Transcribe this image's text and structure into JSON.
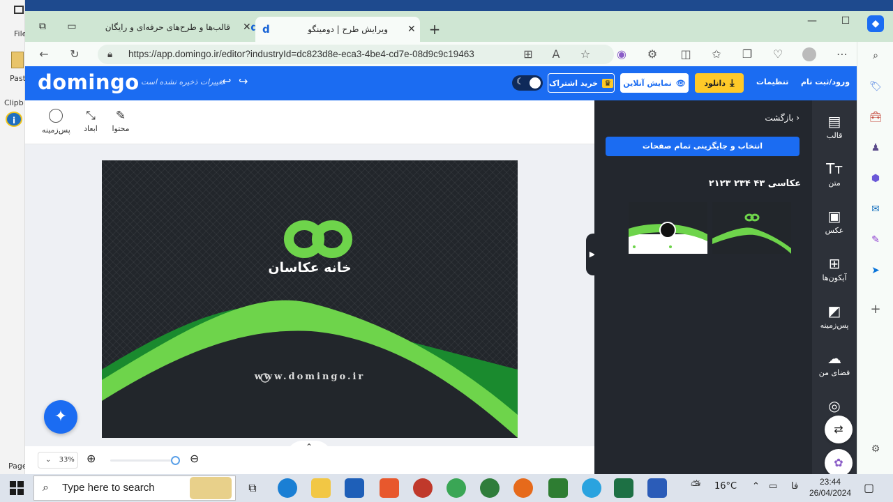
{
  "background_app": {
    "file_label": "File",
    "paste_label": "Past",
    "clipboard_label": "Clipb",
    "page_label": "Page"
  },
  "browser": {
    "tabs": [
      {
        "title": "قالب‌ها و طرح‌های حرفه‌ای و رایگان",
        "active": false
      },
      {
        "title": "ویرایش طرح | دومینگو",
        "active": true
      }
    ],
    "url": "https://app.domingo.ir/editor?industryId=dc823d8e-eca3-4be4-cd7e-08d9c9c19463"
  },
  "header": {
    "logo": "domingo",
    "unsaved": "تغییرات ذخیره نشده است",
    "subscribe": "خرید اشتراک",
    "live_preview": "نمایش آنلاین",
    "download": "دانلود",
    "settings": "تنظیمات",
    "login": "ورود/ثبت نام"
  },
  "toolbar": {
    "background": "پس‌زمینه",
    "dimensions": "ابعاد",
    "content": "محتوا"
  },
  "card": {
    "brand": "خانه عکاسان",
    "website": "www.domingo.ir"
  },
  "zoom": {
    "level": "33%"
  },
  "panel": {
    "back": "بازگشت",
    "select_all": "انتخاب و جایگزینی تمام صفحات",
    "template_title": "عکاسی ۴۳ ۲۳۴ ۲۱۲۳"
  },
  "sidebar_icons": [
    {
      "label": "قالب",
      "icon": "template-icon"
    },
    {
      "label": "متن",
      "icon": "text-icon"
    },
    {
      "label": "عکس",
      "icon": "image-icon"
    },
    {
      "label": "آیکون‌ها",
      "icon": "icons-grid-icon"
    },
    {
      "label": "پس‌زمینه",
      "icon": "background-icon"
    },
    {
      "label": "فضای من",
      "icon": "cloud-upload-icon"
    }
  ],
  "taskbar": {
    "search_placeholder": "Type here to search",
    "temperature": "16°C",
    "language": "فا",
    "time": "23:44",
    "date": "26/04/2024"
  },
  "colors": {
    "brand_blue": "#1b6cf2",
    "download_yellow": "#ffc928",
    "panel_dark": "#23272e",
    "card_green": "#6ed44b"
  }
}
